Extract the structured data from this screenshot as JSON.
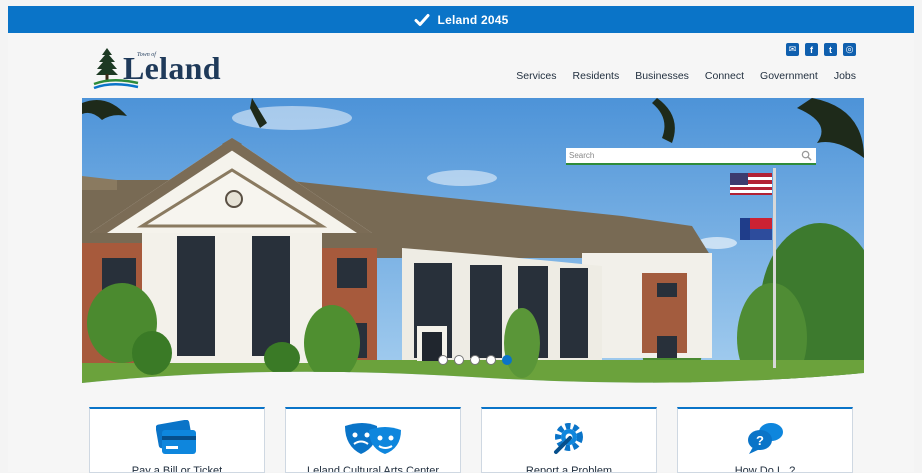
{
  "topbar": {
    "label": "Leland 2045",
    "icon": "check-icon"
  },
  "logo": {
    "small": "Town of",
    "name": "Leland"
  },
  "social": {
    "email": "✉",
    "facebook": "f",
    "twitter": "t",
    "instagram": "◎"
  },
  "nav": {
    "items": [
      "Services",
      "Residents",
      "Businesses",
      "Connect",
      "Government",
      "Jobs"
    ]
  },
  "search": {
    "placeholder": "Search"
  },
  "carousel": {
    "slide_count": 5,
    "active_index": 4
  },
  "cards": [
    {
      "label": "Pay a Bill or Ticket",
      "icon": "credit-card-icon"
    },
    {
      "label": "Leland Cultural Arts Center",
      "icon": "theater-masks-icon"
    },
    {
      "label": "Report a Problem",
      "icon": "wrench-gear-icon"
    },
    {
      "label": "How Do I...?",
      "icon": "chat-question-icon"
    }
  ],
  "colors": {
    "brand_blue": "#0a74c8",
    "accent_green": "#2e8b3a",
    "nav_text": "#1f2d3d"
  }
}
